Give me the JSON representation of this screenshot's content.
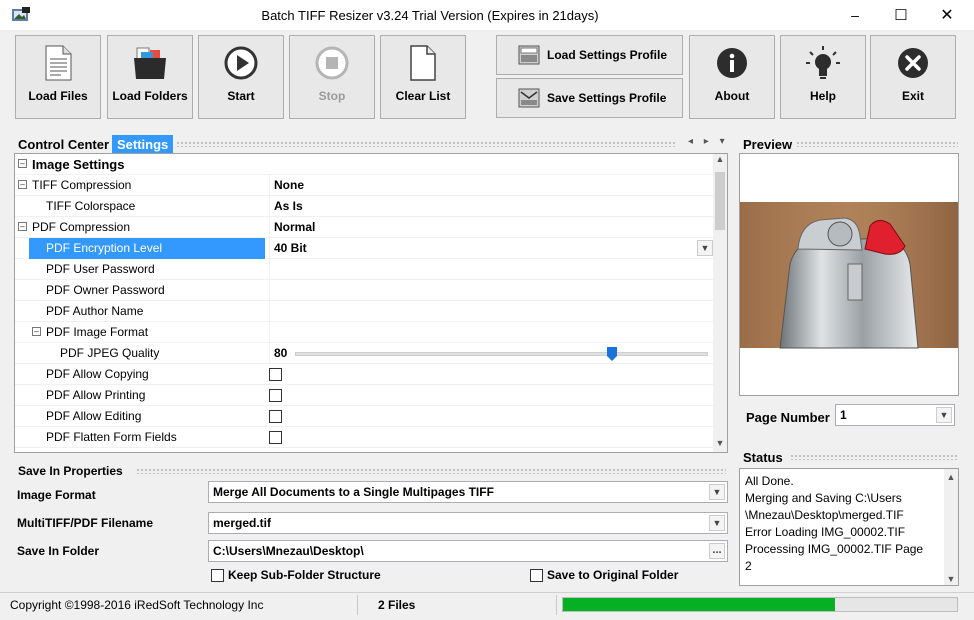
{
  "window": {
    "title": "Batch TIFF Resizer v3.24   Trial Version (Expires in 21days)",
    "minimize_glyph": "–",
    "maximize_glyph": "☐",
    "close_glyph": "✕"
  },
  "toolbar": {
    "load_files": "Load Files",
    "load_folders": "Load Folders",
    "start": "Start",
    "stop": "Stop",
    "clear_list": "Clear List",
    "load_profile": "Load Settings Profile",
    "save_profile": "Save Settings Profile",
    "about": "About",
    "help": "Help",
    "exit": "Exit"
  },
  "tabs": {
    "control_center": "Control Center",
    "settings": "Settings",
    "nav_glyphs": "◂ ▸ ▾"
  },
  "grid": {
    "category": "Image Settings",
    "rows": [
      {
        "name": "TIFF Compression",
        "value": "None"
      },
      {
        "name": "TIFF Colorspace",
        "value": "As Is"
      },
      {
        "name": "PDF Compression",
        "value": "Normal"
      },
      {
        "name": "PDF Encryption Level",
        "value": "40 Bit"
      },
      {
        "name": "PDF User Password",
        "value": ""
      },
      {
        "name": "PDF Owner Password",
        "value": ""
      },
      {
        "name": "PDF Author Name",
        "value": ""
      },
      {
        "name": "PDF Image Format",
        "value": ""
      },
      {
        "name": "PDF JPEG Quality",
        "value": "80"
      },
      {
        "name": "PDF Allow Copying",
        "value": ""
      },
      {
        "name": "PDF Allow Printing",
        "value": ""
      },
      {
        "name": "PDF Allow Editing",
        "value": ""
      },
      {
        "name": "PDF Flatten Form Fields",
        "value": ""
      }
    ],
    "jpeg_quality_fraction": 0.77
  },
  "save": {
    "header": "Save In Properties",
    "image_format_label": "Image Format",
    "image_format_value": "Merge All Documents to a Single Multipages TIFF",
    "filename_label": "MultiTIFF/PDF Filename",
    "filename_value": "merged.tif",
    "folder_label": "Save In Folder",
    "folder_value": "C:\\Users\\Mnezau\\Desktop\\",
    "browse_label": "...",
    "keep_structure": "Keep Sub-Folder Structure",
    "save_original": "Save to Original Folder"
  },
  "preview": {
    "header": "Preview",
    "page_number_label": "Page Number",
    "page_number_value": "1"
  },
  "status": {
    "header": "Status",
    "lines": [
      "All Done.",
      "Merging and Saving C:\\Users",
      "\\Mnezau\\Desktop\\merged.TIF",
      "Error Loading IMG_00002.TIF",
      "Processing IMG_00002.TIF Page",
      "2"
    ]
  },
  "statusbar": {
    "copyright": "Copyright ©1998-2016 iRedSoft Technology Inc",
    "file_count": "2 Files",
    "progress_fraction": 0.69,
    "progress_color": "#06b025"
  },
  "colors": {
    "selection": "#3399ff",
    "accent_tab": "#3399ff"
  }
}
